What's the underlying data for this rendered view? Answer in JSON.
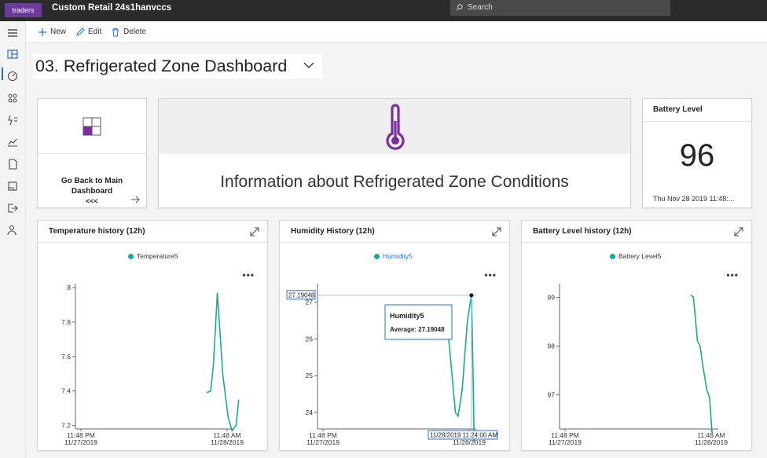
{
  "topbar": {
    "logo": "traders",
    "app_title": "Custom Retail 24s1hanvccs",
    "search_placeholder": "Search"
  },
  "toolbar": {
    "new_label": "New",
    "edit_label": "Edit",
    "delete_label": "Delete"
  },
  "dashboard": {
    "title": "03. Refrigerated Zone Dashboard"
  },
  "tiles": {
    "back": {
      "label": "Go Back to Main Dashboard",
      "sub": "<<<"
    },
    "info": {
      "text": "Information about Refrigerated Zone Conditions"
    },
    "battery": {
      "title": "Battery Level",
      "value": "96",
      "timestamp": "Thu Nov 28 2019 11:48:..."
    }
  },
  "colors": {
    "accent": "#1aa99a",
    "brand": "#6c3a99",
    "thermo": "#7b2d9e"
  },
  "chart_data": [
    {
      "type": "line",
      "title": "Temperature history (12h)",
      "series": [
        {
          "name": "Temperature5",
          "points": [
            [
              0.0,
              7.39
            ],
            [
              0.03,
              7.4
            ],
            [
              0.05,
              7.55
            ],
            [
              0.08,
              7.97
            ],
            [
              0.12,
              7.5
            ],
            [
              0.16,
              7.25
            ],
            [
              0.19,
              7.17
            ],
            [
              0.22,
              7.2
            ],
            [
              0.24,
              7.35
            ]
          ]
        }
      ],
      "y_ticks": [
        "8",
        "7.8",
        "7.6",
        "7.4",
        "7.2"
      ],
      "ylim": [
        7.18,
        8.0
      ],
      "x_ticks": [
        [
          "11:48 PM",
          "11/27/2019"
        ],
        [
          "11:48 AM",
          "11/28/2019"
        ]
      ]
    },
    {
      "type": "line",
      "title": "Humidity History (12h)",
      "series": [
        {
          "name": "Humidity5",
          "points": [
            [
              0.0,
              26.0
            ],
            [
              0.02,
              25.2
            ],
            [
              0.05,
              24.0
            ],
            [
              0.07,
              23.9
            ],
            [
              0.1,
              24.6
            ],
            [
              0.14,
              26.5
            ],
            [
              0.17,
              27.19
            ],
            [
              0.18,
              25.5
            ],
            [
              0.19,
              23.2
            ]
          ]
        }
      ],
      "y_ticks": [
        "27",
        "26",
        "25",
        "24"
      ],
      "ylim": [
        23.55,
        27.4
      ],
      "x_ticks": [
        [
          "11:48 PM",
          "11/27/2019"
        ],
        [
          "11:48 AM",
          "11/28/2019"
        ]
      ],
      "crosshair_value": "27.19048",
      "crosshair_time": "11/28/2019 11:24:00 AM",
      "tooltip": {
        "series": "Humidity5",
        "text": "Average: 27.19048"
      }
    },
    {
      "type": "line",
      "title": "Battery Level history (12h)",
      "series": [
        {
          "name": "Battery Level5",
          "points": [
            [
              0.0,
              99.05
            ],
            [
              0.02,
              99.0
            ],
            [
              0.04,
              98.4
            ],
            [
              0.05,
              98.1
            ],
            [
              0.07,
              98.0
            ],
            [
              0.09,
              97.6
            ],
            [
              0.12,
              97.1
            ],
            [
              0.14,
              96.95
            ],
            [
              0.16,
              96.2
            ]
          ]
        }
      ],
      "y_ticks": [
        "99",
        "98",
        "97"
      ],
      "ylim": [
        96.3,
        99.2
      ],
      "x_ticks": [
        [
          "11:48 PM",
          "11/27/2019"
        ],
        [
          "11:48 AM",
          "11/28/2019"
        ]
      ]
    }
  ]
}
